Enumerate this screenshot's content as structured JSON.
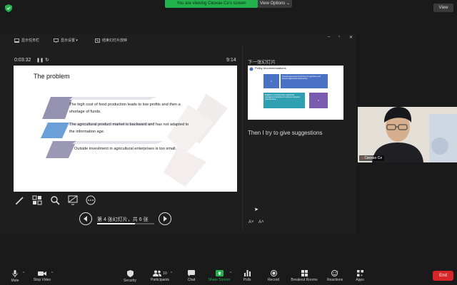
{
  "banner": {
    "text": "You are viewing Свохан Се's screen",
    "options": "View Options ⌄"
  },
  "view_button": "View",
  "presenter": {
    "toolbar": [
      {
        "label": "显示任务栏"
      },
      {
        "label": "显示设置 ▾"
      },
      {
        "label": "结束幻灯片放映"
      }
    ],
    "window_controls": {
      "minimize": "–",
      "restore": "▫",
      "close": "✕"
    },
    "timer": "0:03:32",
    "clock": "9:14",
    "slide": {
      "title": "The problem",
      "lines": [
        "The high cost of food production leads to low profits and then a shortage of funds.",
        "The agricultural product market is backward and has not adapted to the information age.",
        "Outside investment in agricultural enterprises is too small."
      ]
    },
    "navigation": {
      "page_label": "第 4 张幻灯片，共 6 张",
      "current": 4,
      "total": 6
    },
    "next_slide": {
      "label": "下一张幻灯片",
      "title": "Policy recommendations",
      "box_top_text": "Increase government investment in agriculture and improve agricultural infrastructure",
      "box_left_text": "Establish a comprehensive agricultural management department to improve domestic manufacturing...",
      "box_mid_label": "1",
      "box_right_label": "2"
    },
    "note": "Then I try to give suggestions",
    "font_small": "A˅",
    "font_large": "A˄"
  },
  "video": {
    "name": "Свохан Се"
  },
  "bottom_toolbar": {
    "mute": "Mute",
    "stop_video": "Stop Video",
    "security": "Security",
    "participants": "Participants",
    "participants_count": "10",
    "chat": "Chat",
    "share_screen": "Share Screen",
    "polls": "Polls",
    "record": "Record",
    "breakout": "Breakout Rooms",
    "reactions": "Reactions",
    "apps": "Apps",
    "end": "End"
  },
  "colors": {
    "share_green": "#22b14c",
    "end_red": "#d7262a",
    "slide_band_purple": "#8a86a8",
    "slide_band_blue": "#6a9fd8",
    "thumb_blue": "#4a72c4",
    "thumb_purple": "#7b5bb0",
    "thumb_teal": "#2f9fb2"
  }
}
